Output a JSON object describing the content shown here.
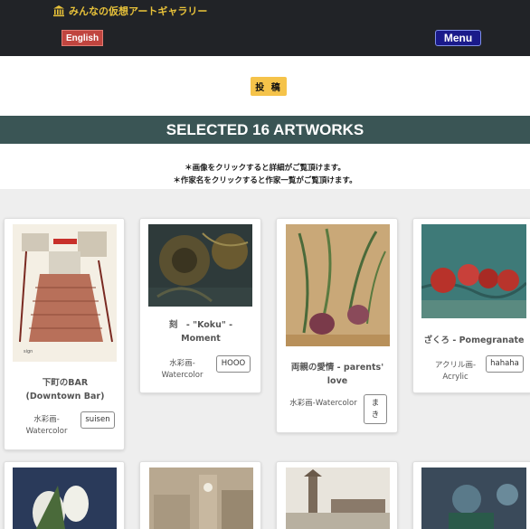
{
  "header": {
    "site_title": "みんなの仮想アートギャラリー",
    "language_button": "English",
    "menu_button": "Menu"
  },
  "post_button": "投 稿",
  "section_title": "SELECTED 16 ARTWORKS",
  "notes": [
    "＊画像をクリックすると詳細がご覧頂けます。",
    "＊作家名をクリックすると作家一覧がご覧頂けます。"
  ],
  "artworks": [
    {
      "title": "下町のBAR (Downtown Bar)",
      "medium": "水彩画-Watercolor",
      "artist": "suisen"
    },
    {
      "title": "刻　- \"Koku\" - Moment",
      "medium": "水彩画-Watercolor",
      "artist": "HOOO"
    },
    {
      "title": "両親の愛情 - parents' love",
      "medium": "水彩画-Watercolor",
      "artist": "まき"
    },
    {
      "title": "ざくろ - Pomegranate",
      "medium": "アクリル画-Acrylic",
      "artist": "hahaha"
    }
  ],
  "icons": {
    "brand": "museum-icon"
  },
  "colors": {
    "topbar": "#212327",
    "brand_text": "#e8c23a",
    "language_button": "#c0453f",
    "menu_button": "#1a1a8a",
    "post_button": "#f5c34a",
    "section_band": "#3a5555"
  }
}
